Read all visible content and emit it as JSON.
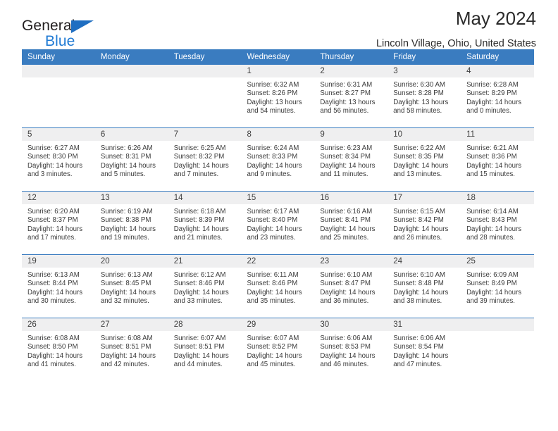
{
  "brand": {
    "name_top": "General",
    "name_bottom": "Blue",
    "triangle_color": "#1f6ec1",
    "blue_text_color": "#1f7ad4"
  },
  "header": {
    "title": "May 2024",
    "subtitle": "Lincoln Village, Ohio, United States",
    "header_bg_color": "#3a7cc0",
    "daynum_strip_color": "#efeff0"
  },
  "weekday_headers": [
    "Sunday",
    "Monday",
    "Tuesday",
    "Wednesday",
    "Thursday",
    "Friday",
    "Saturday"
  ],
  "weeks": [
    [
      {
        "day": "",
        "empty": true
      },
      {
        "day": "",
        "empty": true
      },
      {
        "day": "",
        "empty": true
      },
      {
        "day": "1",
        "sunrise": "Sunrise: 6:32 AM",
        "sunset": "Sunset: 8:26 PM",
        "daylight1": "Daylight: 13 hours",
        "daylight2": "and 54 minutes."
      },
      {
        "day": "2",
        "sunrise": "Sunrise: 6:31 AM",
        "sunset": "Sunset: 8:27 PM",
        "daylight1": "Daylight: 13 hours",
        "daylight2": "and 56 minutes."
      },
      {
        "day": "3",
        "sunrise": "Sunrise: 6:30 AM",
        "sunset": "Sunset: 8:28 PM",
        "daylight1": "Daylight: 13 hours",
        "daylight2": "and 58 minutes."
      },
      {
        "day": "4",
        "sunrise": "Sunrise: 6:28 AM",
        "sunset": "Sunset: 8:29 PM",
        "daylight1": "Daylight: 14 hours",
        "daylight2": "and 0 minutes."
      }
    ],
    [
      {
        "day": "5",
        "sunrise": "Sunrise: 6:27 AM",
        "sunset": "Sunset: 8:30 PM",
        "daylight1": "Daylight: 14 hours",
        "daylight2": "and 3 minutes."
      },
      {
        "day": "6",
        "sunrise": "Sunrise: 6:26 AM",
        "sunset": "Sunset: 8:31 PM",
        "daylight1": "Daylight: 14 hours",
        "daylight2": "and 5 minutes."
      },
      {
        "day": "7",
        "sunrise": "Sunrise: 6:25 AM",
        "sunset": "Sunset: 8:32 PM",
        "daylight1": "Daylight: 14 hours",
        "daylight2": "and 7 minutes."
      },
      {
        "day": "8",
        "sunrise": "Sunrise: 6:24 AM",
        "sunset": "Sunset: 8:33 PM",
        "daylight1": "Daylight: 14 hours",
        "daylight2": "and 9 minutes."
      },
      {
        "day": "9",
        "sunrise": "Sunrise: 6:23 AM",
        "sunset": "Sunset: 8:34 PM",
        "daylight1": "Daylight: 14 hours",
        "daylight2": "and 11 minutes."
      },
      {
        "day": "10",
        "sunrise": "Sunrise: 6:22 AM",
        "sunset": "Sunset: 8:35 PM",
        "daylight1": "Daylight: 14 hours",
        "daylight2": "and 13 minutes."
      },
      {
        "day": "11",
        "sunrise": "Sunrise: 6:21 AM",
        "sunset": "Sunset: 8:36 PM",
        "daylight1": "Daylight: 14 hours",
        "daylight2": "and 15 minutes."
      }
    ],
    [
      {
        "day": "12",
        "sunrise": "Sunrise: 6:20 AM",
        "sunset": "Sunset: 8:37 PM",
        "daylight1": "Daylight: 14 hours",
        "daylight2": "and 17 minutes."
      },
      {
        "day": "13",
        "sunrise": "Sunrise: 6:19 AM",
        "sunset": "Sunset: 8:38 PM",
        "daylight1": "Daylight: 14 hours",
        "daylight2": "and 19 minutes."
      },
      {
        "day": "14",
        "sunrise": "Sunrise: 6:18 AM",
        "sunset": "Sunset: 8:39 PM",
        "daylight1": "Daylight: 14 hours",
        "daylight2": "and 21 minutes."
      },
      {
        "day": "15",
        "sunrise": "Sunrise: 6:17 AM",
        "sunset": "Sunset: 8:40 PM",
        "daylight1": "Daylight: 14 hours",
        "daylight2": "and 23 minutes."
      },
      {
        "day": "16",
        "sunrise": "Sunrise: 6:16 AM",
        "sunset": "Sunset: 8:41 PM",
        "daylight1": "Daylight: 14 hours",
        "daylight2": "and 25 minutes."
      },
      {
        "day": "17",
        "sunrise": "Sunrise: 6:15 AM",
        "sunset": "Sunset: 8:42 PM",
        "daylight1": "Daylight: 14 hours",
        "daylight2": "and 26 minutes."
      },
      {
        "day": "18",
        "sunrise": "Sunrise: 6:14 AM",
        "sunset": "Sunset: 8:43 PM",
        "daylight1": "Daylight: 14 hours",
        "daylight2": "and 28 minutes."
      }
    ],
    [
      {
        "day": "19",
        "sunrise": "Sunrise: 6:13 AM",
        "sunset": "Sunset: 8:44 PM",
        "daylight1": "Daylight: 14 hours",
        "daylight2": "and 30 minutes."
      },
      {
        "day": "20",
        "sunrise": "Sunrise: 6:13 AM",
        "sunset": "Sunset: 8:45 PM",
        "daylight1": "Daylight: 14 hours",
        "daylight2": "and 32 minutes."
      },
      {
        "day": "21",
        "sunrise": "Sunrise: 6:12 AM",
        "sunset": "Sunset: 8:46 PM",
        "daylight1": "Daylight: 14 hours",
        "daylight2": "and 33 minutes."
      },
      {
        "day": "22",
        "sunrise": "Sunrise: 6:11 AM",
        "sunset": "Sunset: 8:46 PM",
        "daylight1": "Daylight: 14 hours",
        "daylight2": "and 35 minutes."
      },
      {
        "day": "23",
        "sunrise": "Sunrise: 6:10 AM",
        "sunset": "Sunset: 8:47 PM",
        "daylight1": "Daylight: 14 hours",
        "daylight2": "and 36 minutes."
      },
      {
        "day": "24",
        "sunrise": "Sunrise: 6:10 AM",
        "sunset": "Sunset: 8:48 PM",
        "daylight1": "Daylight: 14 hours",
        "daylight2": "and 38 minutes."
      },
      {
        "day": "25",
        "sunrise": "Sunrise: 6:09 AM",
        "sunset": "Sunset: 8:49 PM",
        "daylight1": "Daylight: 14 hours",
        "daylight2": "and 39 minutes."
      }
    ],
    [
      {
        "day": "26",
        "sunrise": "Sunrise: 6:08 AM",
        "sunset": "Sunset: 8:50 PM",
        "daylight1": "Daylight: 14 hours",
        "daylight2": "and 41 minutes."
      },
      {
        "day": "27",
        "sunrise": "Sunrise: 6:08 AM",
        "sunset": "Sunset: 8:51 PM",
        "daylight1": "Daylight: 14 hours",
        "daylight2": "and 42 minutes."
      },
      {
        "day": "28",
        "sunrise": "Sunrise: 6:07 AM",
        "sunset": "Sunset: 8:51 PM",
        "daylight1": "Daylight: 14 hours",
        "daylight2": "and 44 minutes."
      },
      {
        "day": "29",
        "sunrise": "Sunrise: 6:07 AM",
        "sunset": "Sunset: 8:52 PM",
        "daylight1": "Daylight: 14 hours",
        "daylight2": "and 45 minutes."
      },
      {
        "day": "30",
        "sunrise": "Sunrise: 6:06 AM",
        "sunset": "Sunset: 8:53 PM",
        "daylight1": "Daylight: 14 hours",
        "daylight2": "and 46 minutes."
      },
      {
        "day": "31",
        "sunrise": "Sunrise: 6:06 AM",
        "sunset": "Sunset: 8:54 PM",
        "daylight1": "Daylight: 14 hours",
        "daylight2": "and 47 minutes."
      },
      {
        "day": "",
        "empty": true
      }
    ]
  ]
}
